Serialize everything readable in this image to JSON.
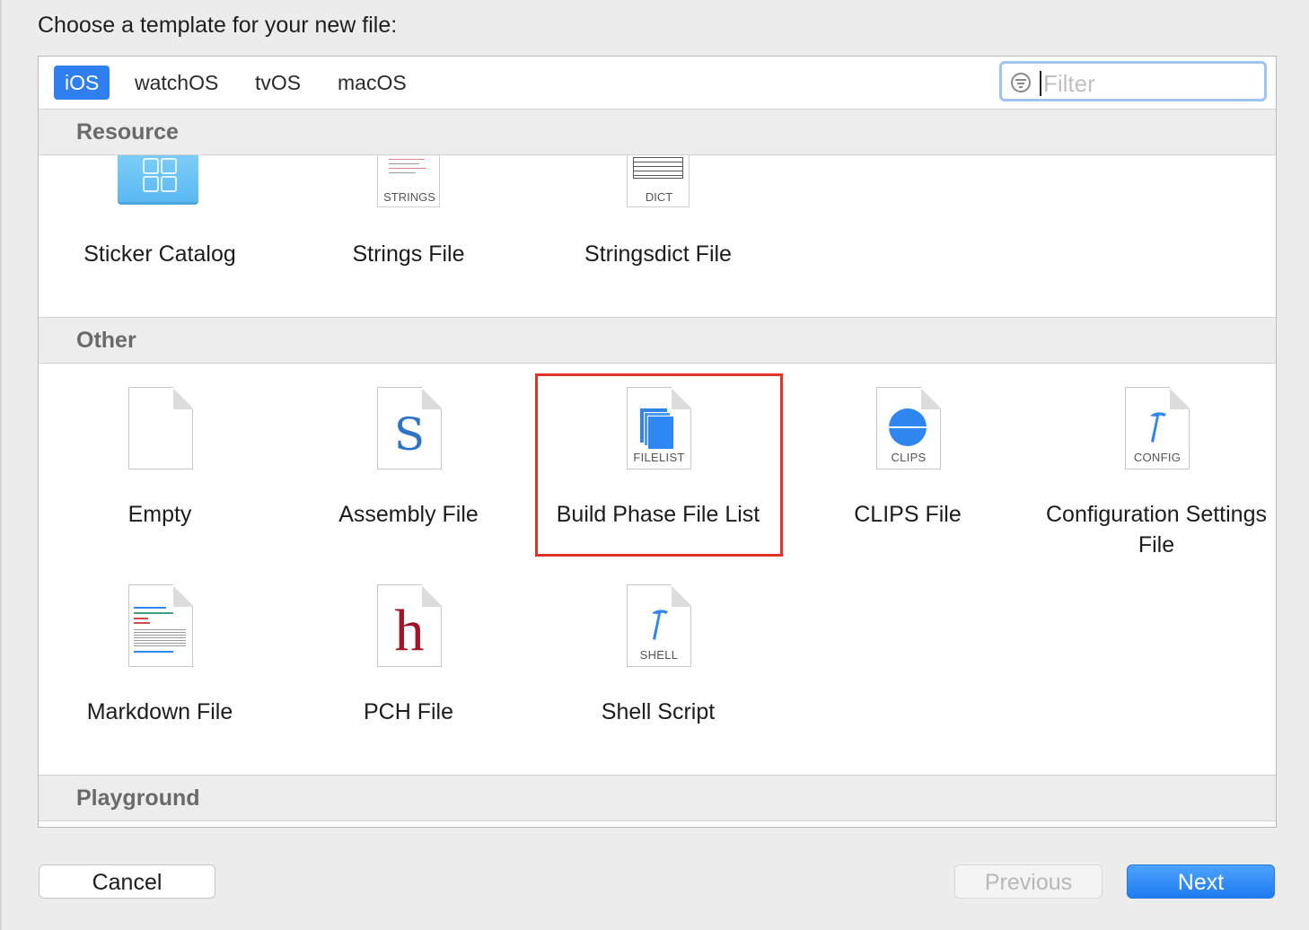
{
  "dialog": {
    "prompt": "Choose a template for your new file:"
  },
  "platform_tabs": [
    {
      "label": "iOS",
      "active": true
    },
    {
      "label": "watchOS",
      "active": false
    },
    {
      "label": "tvOS",
      "active": false
    },
    {
      "label": "macOS",
      "active": false
    }
  ],
  "filter": {
    "placeholder": "Filter",
    "value": "",
    "icon": "filter-icon"
  },
  "sections": [
    {
      "title": "Resource",
      "items": [
        {
          "label": "Sticker Catalog",
          "icon": "sticker-catalog-icon"
        },
        {
          "label": "Strings File",
          "icon": "strings-file-icon",
          "badge": "STRINGS"
        },
        {
          "label": "Stringsdict File",
          "icon": "stringsdict-file-icon",
          "badge": "DICT"
        }
      ]
    },
    {
      "title": "Other",
      "items": [
        {
          "label": "Empty",
          "icon": "empty-file-icon"
        },
        {
          "label": "Assembly File",
          "icon": "assembly-file-icon",
          "glyph": "S"
        },
        {
          "label": "Build Phase File List",
          "icon": "filelist-icon",
          "badge": "FILELIST",
          "highlighted": true
        },
        {
          "label": "CLIPS File",
          "icon": "clips-icon",
          "badge": "CLIPS"
        },
        {
          "label": "Configuration Settings File",
          "icon": "config-icon",
          "badge": "CONFIG"
        },
        {
          "label": "Markdown File",
          "icon": "markdown-file-icon"
        },
        {
          "label": "PCH File",
          "icon": "pch-file-icon",
          "glyph": "h"
        },
        {
          "label": "Shell Script",
          "icon": "shell-script-icon",
          "badge": "SHELL"
        }
      ]
    },
    {
      "title": "Playground",
      "items": []
    }
  ],
  "buttons": {
    "cancel": "Cancel",
    "previous": "Previous",
    "next": "Next"
  },
  "colors": {
    "accent": "#2f7ff0",
    "highlight": "#e2332b",
    "assembly": "#2b73c9",
    "pch": "#a31426"
  }
}
